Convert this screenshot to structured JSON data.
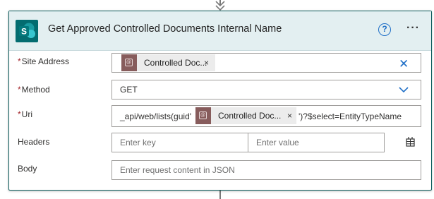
{
  "action": {
    "title": "Get Approved Controlled Documents Internal Name",
    "help_glyph": "?",
    "more_glyph": "···",
    "icon": "sharepoint-logo"
  },
  "fields": {
    "site_address": {
      "label": "Site Address",
      "required_mark": "*",
      "token_text": "Controlled Doc...",
      "token_remove": "×",
      "clear_glyph": "✕"
    },
    "method": {
      "label": "Method",
      "required_mark": "*",
      "value": "GET"
    },
    "uri": {
      "label": "Uri",
      "required_mark": "*",
      "prefix": "_api/web/lists(guid'",
      "token_text": "Controlled Doc...",
      "token_remove": "×",
      "suffix": "')?$select=EntityTypeName"
    },
    "headers": {
      "label": "Headers",
      "key_placeholder": "Enter key",
      "value_placeholder": "Enter value"
    },
    "body": {
      "label": "Body",
      "placeholder": "Enter request content in JSON"
    }
  },
  "colors": {
    "header_bg": "#e3eff1",
    "card_border": "#0b5c5c",
    "token_icon": "#875c5c",
    "accent_blue": "#1f6fc7",
    "required_red": "#a4262c"
  }
}
